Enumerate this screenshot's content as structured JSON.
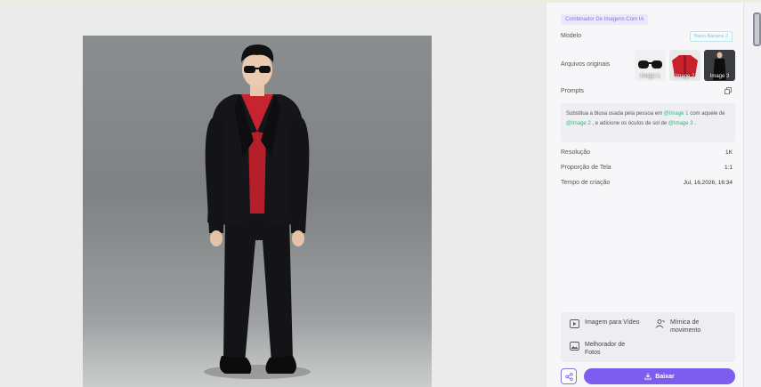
{
  "panel": {
    "badge": "Combinador De Imagens Com IA",
    "model_label": "Modelo",
    "model_value": "Nano Banana 2",
    "originals_label": "Arquivos originais",
    "thumbnails": [
      {
        "label": "Image 1",
        "kind": "sunglasses"
      },
      {
        "label": "Image 2",
        "kind": "red-jacket"
      },
      {
        "label": "Image 3",
        "kind": "black-suit"
      }
    ],
    "prompts_label": "Prompts",
    "prompt": {
      "part1": "Substitua a blusa usada pela pessoa em ",
      "tag1": "@Image 1",
      "part2": " com aquele de ",
      "tag2": "@Image 2",
      "part3": " , e adicione os óculos de sol de ",
      "tag3": "@Image 3",
      "part4": " ."
    },
    "resolution_label": "Resolução",
    "resolution_value": "1K",
    "aspect_label": "Proporção de Tela",
    "aspect_value": "1:1",
    "created_label": "Tempo de criação",
    "created_value": "Jul, 16,2026, 16:34"
  },
  "tools": {
    "image_to_video": "Imagem para Vídeo",
    "motion_mimic": "Mímica de movimento",
    "photo_enhancer": "Melhorador de Fotos"
  },
  "actions": {
    "download": "Baixar"
  },
  "colors": {
    "accent": "#7d5cf0",
    "tag_green": "#2fb97a",
    "badge_bg": "#ece7fb"
  }
}
